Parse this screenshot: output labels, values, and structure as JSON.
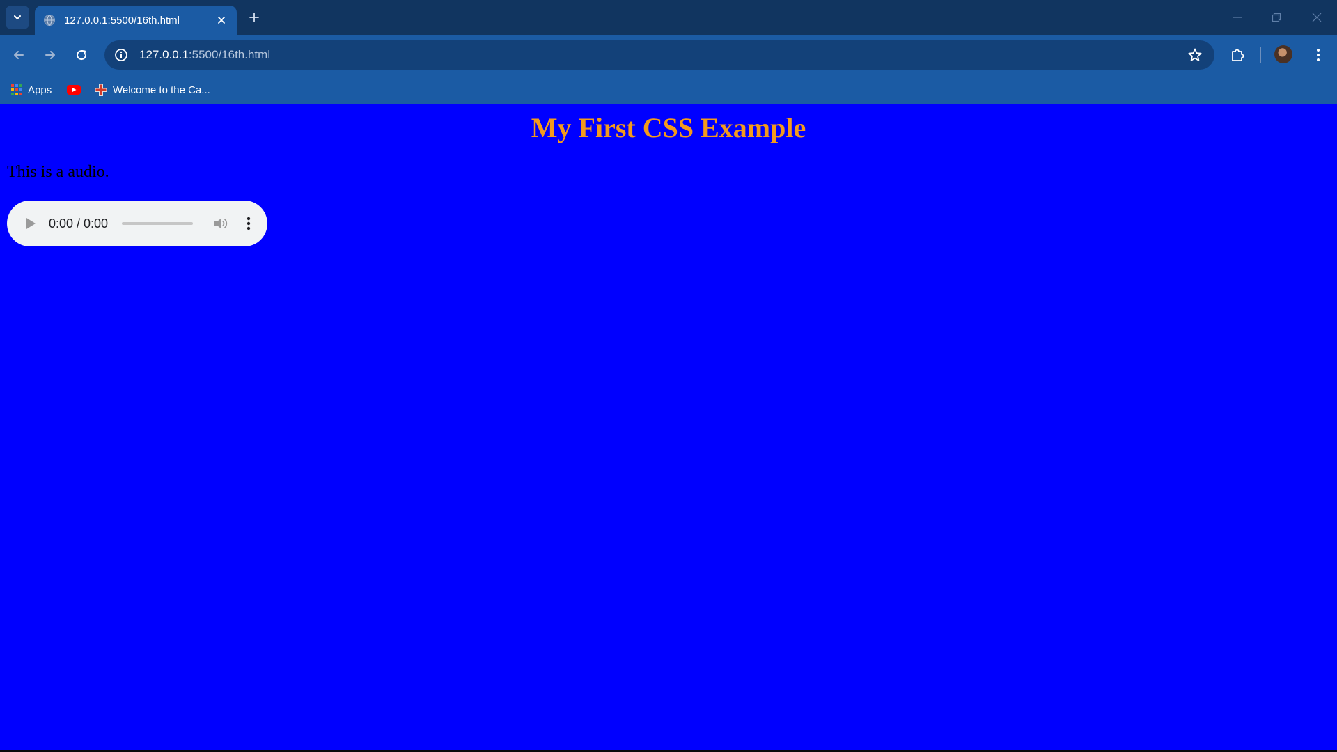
{
  "browser": {
    "tab": {
      "title": "127.0.0.1:5500/16th.html"
    },
    "address_bar": {
      "url_host": "127.0.0.1",
      "url_rest": ":5500/16th.html"
    },
    "bookmarks": [
      {
        "label": "Apps",
        "icon": "apps-grid-icon"
      },
      {
        "label": "",
        "icon": "youtube-icon"
      },
      {
        "label": "Welcome to the Ca...",
        "icon": "site-favicon-icon"
      }
    ],
    "colors": {
      "title_bar": "#113560",
      "toolbar": "#1b5ba4",
      "omnibox": "#134179"
    }
  },
  "page": {
    "background": "#0000ff",
    "heading": "My First CSS Example",
    "heading_color": "#f39a1c",
    "text": "This is a audio.",
    "audio": {
      "time": "0:00 / 0:00",
      "progress": 0
    }
  }
}
